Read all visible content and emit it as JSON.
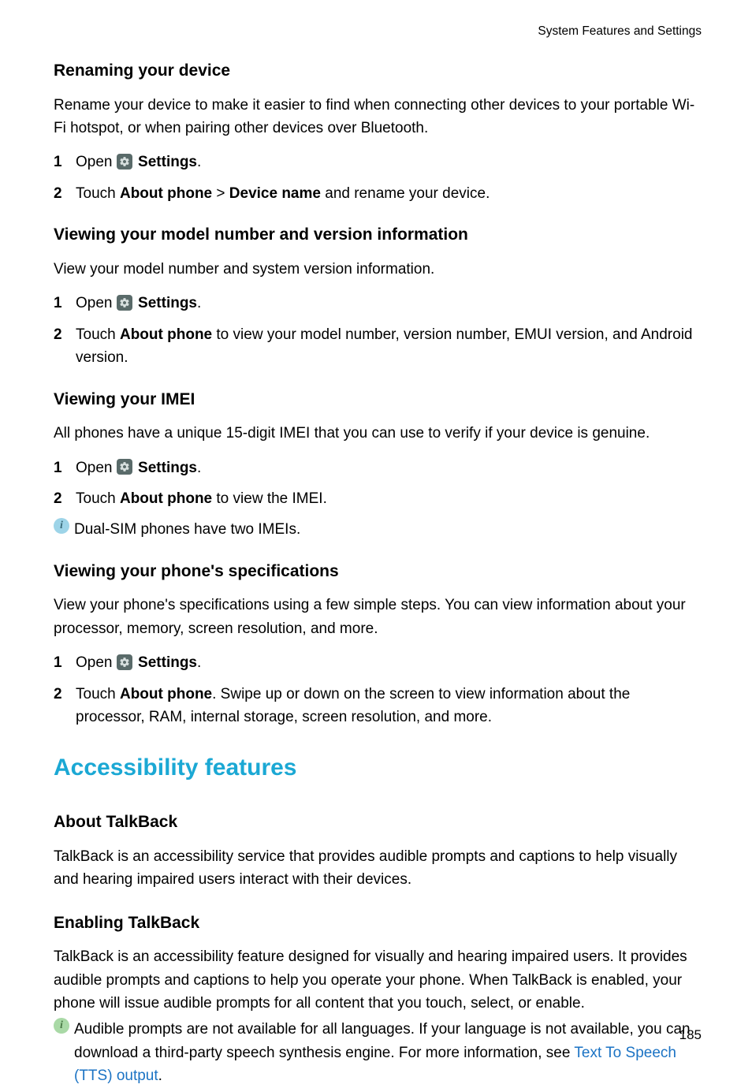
{
  "header": {
    "section_label": "System Features and Settings"
  },
  "renaming": {
    "title": "Renaming your device",
    "intro": "Rename your device to make it easier to find when connecting other devices to your portable Wi-Fi hotspot, or when pairing other devices over Bluetooth.",
    "step1_open": "Open ",
    "settings_word": "Settings",
    "period": ".",
    "step2_touch": "Touch ",
    "about_phone": "About phone",
    "gt": " > ",
    "device_name": "Device name",
    "step2_rest": " and rename your device."
  },
  "model": {
    "title": "Viewing your model number and version information",
    "intro": "View your model number and system version information.",
    "step1_open": "Open ",
    "settings_word": "Settings",
    "period": ".",
    "step2_touch": "Touch ",
    "about_phone": "About phone",
    "step2_rest": " to view your model number, version number, EMUI version, and Android version."
  },
  "imei": {
    "title": "Viewing your IMEI",
    "intro": "All phones have a unique 15-digit IMEI that you can use to verify if your device is genuine.",
    "step1_open": "Open ",
    "settings_word": "Settings",
    "period": ".",
    "step2_touch": "Touch ",
    "about_phone": "About phone",
    "step2_rest": " to view the IMEI.",
    "note": "Dual-SIM phones have two IMEIs."
  },
  "specs": {
    "title": "Viewing your phone's specifications",
    "intro": "View your phone's specifications using a few simple steps. You can view information about your processor, memory, screen resolution, and more.",
    "step1_open": "Open ",
    "settings_word": "Settings",
    "period": ".",
    "step2_touch": "Touch ",
    "about_phone": "About phone",
    "step2_rest": ". Swipe up or down on the screen to view information about the processor, RAM, internal storage, screen resolution, and more."
  },
  "accessibility": {
    "title": "Accessibility features"
  },
  "talkback_about": {
    "title": "About TalkBack",
    "body": "TalkBack is an accessibility service that provides audible prompts and captions to help visually and hearing impaired users interact with their devices."
  },
  "talkback_enable": {
    "title": "Enabling TalkBack",
    "body": "TalkBack is an accessibility feature designed for visually and hearing impaired users. It provides audible prompts and captions to help you operate your phone. When TalkBack is enabled, your phone will issue audible prompts for all content that you touch, select, or enable.",
    "note_part1": "Audible prompts are not available for all languages. If your language is not available, you can download a third-party speech synthesis engine. For more information, see ",
    "link_text": "Text To Speech (TTS) output",
    "note_part2": "."
  },
  "page_number": "185"
}
